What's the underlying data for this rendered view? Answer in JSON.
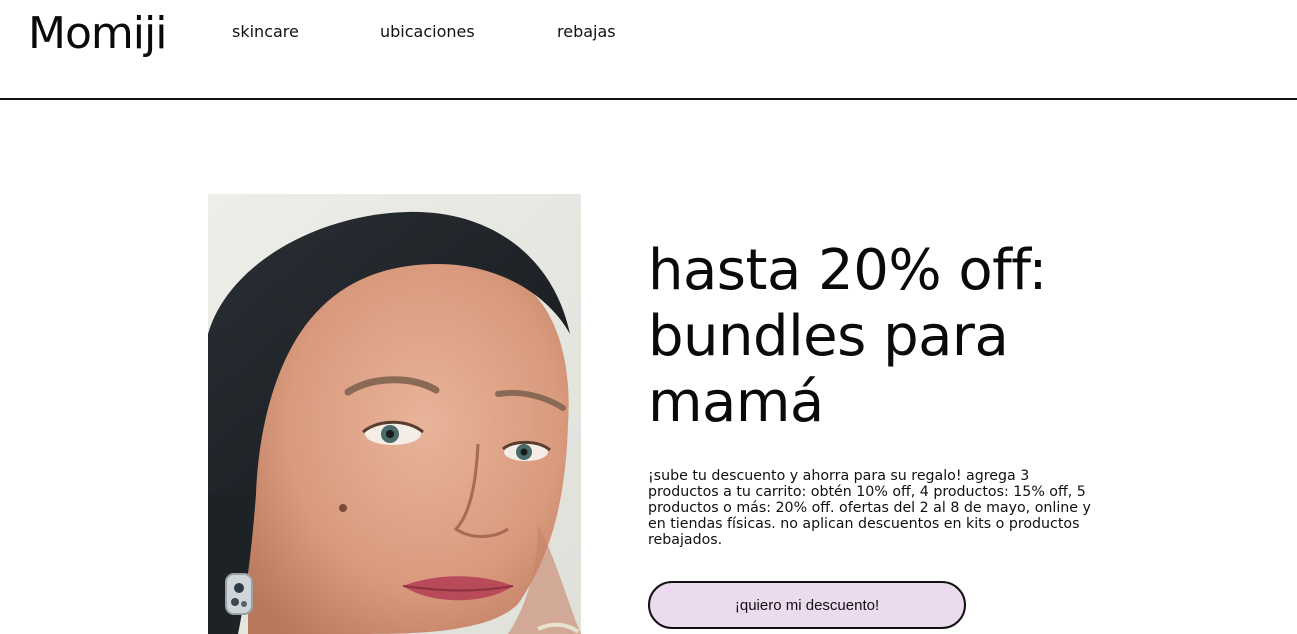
{
  "brand": {
    "logo_text": "Momiji"
  },
  "nav": {
    "items": [
      {
        "label": "skincare"
      },
      {
        "label": "ubicaciones"
      },
      {
        "label": "rebajas"
      }
    ]
  },
  "hero": {
    "image_subject": "portrait of a woman",
    "headline": "hasta 20% off: bundles para mamá",
    "description": "¡sube tu descuento y ahorra para su regalo! agrega 3 productos a tu carrito: obtén 10% off, 4 productos: 15% off, 5 productos o más: 20% off. ofertas del 2 al 8 de mayo, online y en tiendas físicas. no aplican descuentos en kits o productos rebajados.",
    "cta_label": "¡quiero mi descuento!"
  },
  "colors": {
    "background": "#ffffff",
    "text": "#0a0a0a",
    "header_rule": "#111111",
    "cta_fill": "#ecdaee",
    "cta_border": "#111111"
  }
}
